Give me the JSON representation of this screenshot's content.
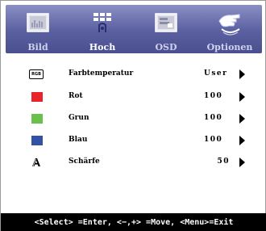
{
  "tabs": [
    {
      "label": "Bild",
      "icon": "picture-icon",
      "active": false
    },
    {
      "label": "Hoch",
      "icon": "advanced-icon",
      "active": true
    },
    {
      "label": "OSD",
      "icon": "osd-icon",
      "active": false
    },
    {
      "label": "Optionen",
      "icon": "options-hand-icon",
      "active": false
    }
  ],
  "rows": [
    {
      "icon": "rgb-icon",
      "icon_text": "RGB",
      "label": "Farbtemperatur",
      "value": "User"
    },
    {
      "icon": "red-square-icon",
      "label": "Rot",
      "value": "100"
    },
    {
      "icon": "green-square-icon",
      "label": "Grun",
      "value": "100"
    },
    {
      "icon": "blue-square-icon",
      "label": "Blau",
      "value": "100"
    },
    {
      "icon": "sharpness-icon",
      "label": "Schärfe",
      "value": "50"
    }
  ],
  "status_bar": "<Select> =Enter, <−,+> =Move, <Menu>=Exit",
  "colors": {
    "tab_bar": "#5a5fa0",
    "red": "#e8242a",
    "green": "#6ac04c",
    "blue": "#3452a2",
    "status_bg": "#000000"
  }
}
